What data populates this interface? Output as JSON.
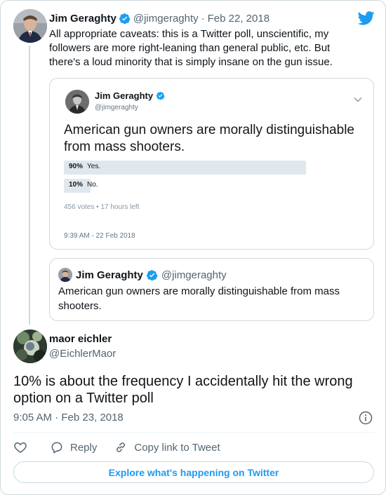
{
  "parent_tweet": {
    "author_name": "Jim Geraghty",
    "author_handle": "@jimgeraghty",
    "separator": "·",
    "date": "Feb 22, 2018",
    "text": "All appropriate caveats: this is a Twitter poll, unscientific, my followers are more right-leaning than general public, etc. But there's a loud minority that is simply insane on the gun issue."
  },
  "poll_card": {
    "author_name": "Jim Geraghty",
    "author_handle": "@jimgeraghty",
    "question": "American gun owners are morally distinguishable from mass shooters.",
    "options": [
      {
        "percent": "90%",
        "label": "Yes.",
        "fraction": 0.9
      },
      {
        "percent": "10%",
        "label": "No.",
        "fraction": 0.1
      }
    ],
    "meta": "456 votes • 17 hours left",
    "timestamp": "9:39 AM - 22 Feb 2018"
  },
  "quoted_tweet": {
    "author_name": "Jim Geraghty",
    "author_handle": "@jimgeraghty",
    "text": "American gun owners are morally distinguishable from mass shooters."
  },
  "main_tweet": {
    "author_name": "maor eichler",
    "author_handle": "@EichlerMaor",
    "text": "10% is about the frequency I accidentally hit the wrong option on a Twitter poll",
    "timestamp": "9:05 AM · Feb 23, 2018"
  },
  "actions": {
    "like_icon": "heart-icon",
    "reply_label": "Reply",
    "copy_link_label": "Copy link to Tweet"
  },
  "explore_button": {
    "label": "Explore what's happening on Twitter"
  },
  "colors": {
    "accent": "#1d9bf0",
    "secondary_text": "#536471",
    "border": "#cfd9de",
    "poll_bar": "#e1e8ed"
  }
}
